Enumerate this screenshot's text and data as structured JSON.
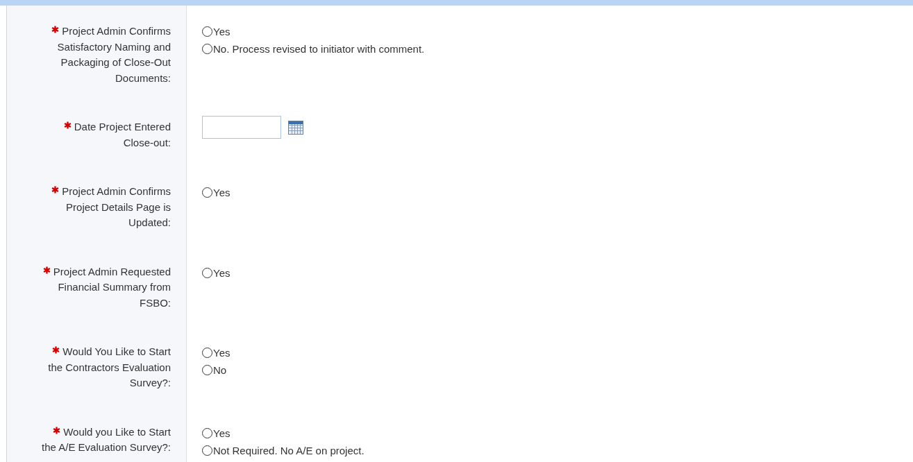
{
  "form": {
    "rows": [
      {
        "label": "Project Admin Confirms Satisfactory Naming and Packaging of Close-Out Documents:",
        "required": true,
        "kind": "radio",
        "options": [
          {
            "label": "Yes",
            "selected": false
          },
          {
            "label": "No. Process revised to initiator with comment.",
            "selected": false
          }
        ]
      },
      {
        "label": "Date Project Entered Close-out:",
        "required": true,
        "kind": "date"
      },
      {
        "label": "Project Admin Confirms Project Details Page is Updated:",
        "required": true,
        "kind": "radio",
        "options": [
          {
            "label": "Yes",
            "selected": false
          }
        ]
      },
      {
        "label": "Project Admin Requested Financial Summary from FSBO:",
        "required": true,
        "kind": "radio",
        "options": [
          {
            "label": "Yes",
            "selected": false
          }
        ]
      },
      {
        "label": "Would You Like to Start the Contractors Evaluation Survey?:",
        "required": true,
        "kind": "radio",
        "options": [
          {
            "label": "Yes",
            "selected": false
          },
          {
            "label": "No",
            "selected": false
          }
        ]
      },
      {
        "label": "Would you Like to Start the A/E Evaluation Survey?:",
        "required": true,
        "kind": "radio",
        "options": [
          {
            "label": "Yes",
            "selected": false
          },
          {
            "label": "Not Required. No A/E on project.",
            "selected": false
          }
        ]
      }
    ]
  }
}
